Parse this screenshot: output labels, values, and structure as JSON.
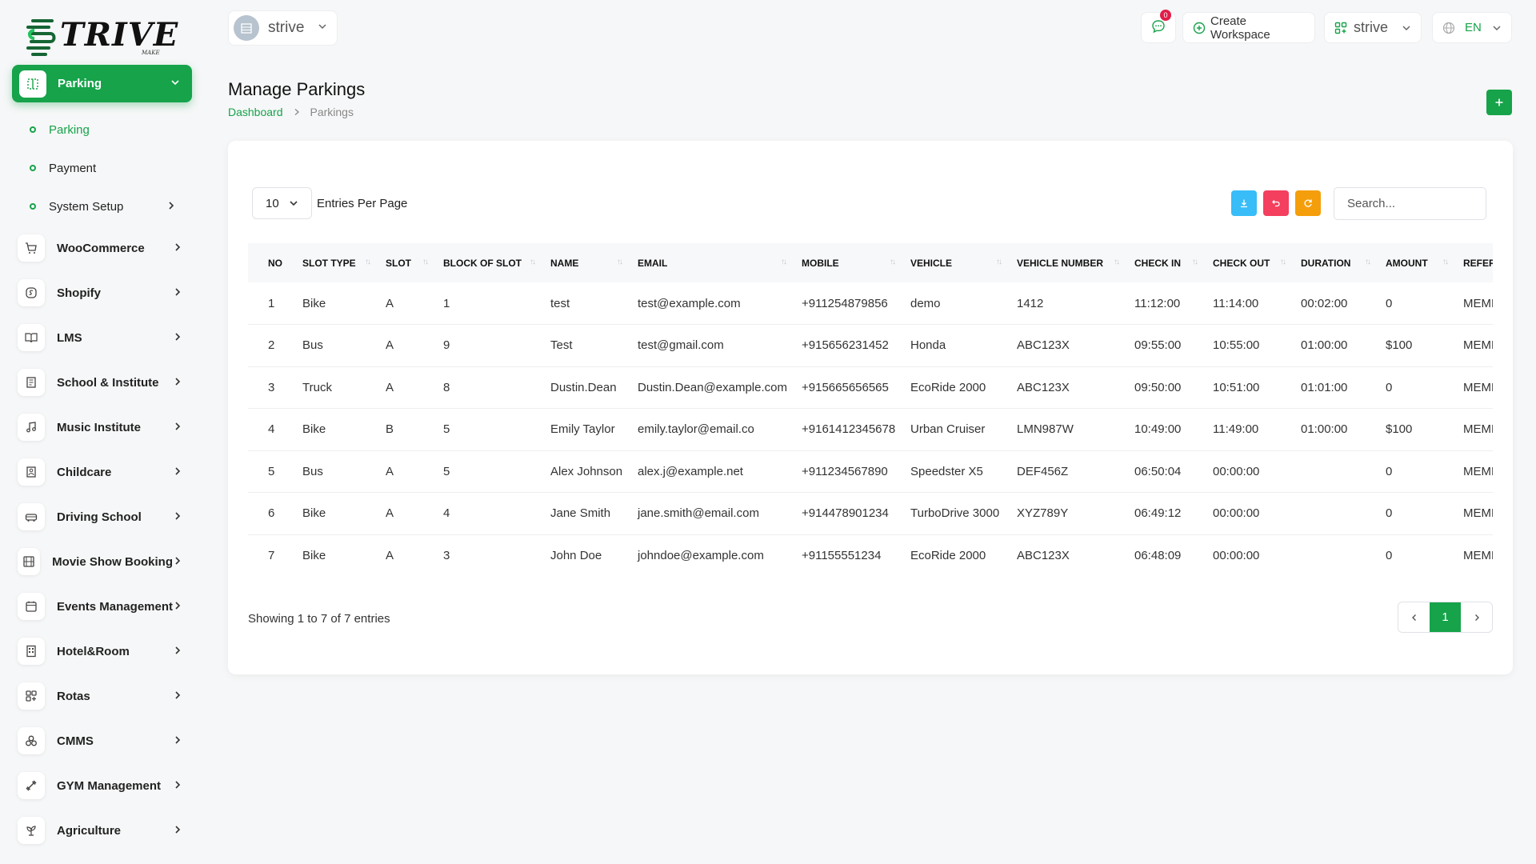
{
  "brand": {
    "logo_text": "TRIVE",
    "logo_sub": "MAKE",
    "accent": "#16a34a"
  },
  "workspace": {
    "name": "strive"
  },
  "topbar": {
    "notification_count": "0",
    "create_workspace_label": "Create Workspace",
    "workspace_switch_label": "strive",
    "language_label": "EN"
  },
  "sidebar": {
    "active": {
      "label": "Parking",
      "icon": "parking-icon"
    },
    "subitems": [
      {
        "label": "Parking",
        "active": true
      },
      {
        "label": "Payment"
      },
      {
        "label": "System Setup",
        "has_children": true
      }
    ],
    "items": [
      {
        "label": "WooCommerce",
        "icon": "cart-icon"
      },
      {
        "label": "Shopify",
        "icon": "shopify-icon"
      },
      {
        "label": "LMS",
        "icon": "book-icon"
      },
      {
        "label": "School & Institute",
        "icon": "school-icon"
      },
      {
        "label": "Music Institute",
        "icon": "music-icon"
      },
      {
        "label": "Childcare",
        "icon": "childcare-icon"
      },
      {
        "label": "Driving School",
        "icon": "car-icon"
      },
      {
        "label": "Movie Show Booking",
        "icon": "movie-icon"
      },
      {
        "label": "Events Management",
        "icon": "calendar-icon"
      },
      {
        "label": "Hotel&Room",
        "icon": "hotel-icon"
      },
      {
        "label": "Rotas",
        "icon": "grid-icon"
      },
      {
        "label": "CMMS",
        "icon": "cmms-icon"
      },
      {
        "label": "GYM Management",
        "icon": "dumbbell-icon"
      },
      {
        "label": "Agriculture",
        "icon": "plant-icon"
      }
    ]
  },
  "header": {
    "title": "Manage Parkings",
    "breadcrumb_home": "Dashboard",
    "breadcrumb_current": "Parkings"
  },
  "table_controls": {
    "entries_value": "10",
    "entries_label": "Entries Per Page",
    "search_placeholder": "Search...",
    "tool_colors": {
      "export": "#38bdf8",
      "undo": "#f43f5e",
      "refresh": "#f59e0b"
    }
  },
  "table": {
    "columns": [
      "NO",
      "SLOT TYPE",
      "SLOT",
      "BLOCK OF SLOT",
      "NAME",
      "EMAIL",
      "MOBILE",
      "VEHICLE",
      "VEHICLE NUMBER",
      "CHECK IN",
      "CHECK OUT",
      "DURATION",
      "AMOUNT",
      "REFER"
    ],
    "rows": [
      [
        "1",
        "Bike",
        "A",
        "1",
        "test",
        "test@example.com",
        "+911254879856",
        "demo",
        "1412",
        "11:12:00",
        "11:14:00",
        "00:02:00",
        "0",
        "MEMB"
      ],
      [
        "2",
        "Bus",
        "A",
        "9",
        "Test",
        "test@gmail.com",
        "+915656231452",
        "Honda",
        "ABC123X",
        "09:55:00",
        "10:55:00",
        "01:00:00",
        "$100",
        "MEMB"
      ],
      [
        "3",
        "Truck",
        "A",
        "8",
        "Dustin.Dean",
        "Dustin.Dean@example.com",
        "+915665656565",
        "EcoRide 2000",
        "ABC123X",
        "09:50:00",
        "10:51:00",
        "01:01:00",
        "0",
        "MEMB"
      ],
      [
        "4",
        "Bike",
        "B",
        "5",
        "Emily Taylor",
        "emily.taylor@email.co",
        "+9161412345678",
        "Urban Cruiser",
        "LMN987W",
        "10:49:00",
        "11:49:00",
        "01:00:00",
        "$100",
        "MEMB"
      ],
      [
        "5",
        "Bus",
        "A",
        "5",
        "Alex Johnson",
        "alex.j@example.net",
        "+911234567890",
        "Speedster X5",
        "DEF456Z",
        "06:50:04",
        "00:00:00",
        "",
        "0",
        "MEMB"
      ],
      [
        "6",
        "Bike",
        "A",
        "4",
        "Jane Smith",
        "jane.smith@email.com",
        "+914478901234",
        "TurboDrive 3000",
        "XYZ789Y",
        "06:49:12",
        "00:00:00",
        "",
        "0",
        "MEMB"
      ],
      [
        "7",
        "Bike",
        "A",
        "3",
        "John Doe",
        "johndoe@example.com",
        "+91155551234",
        "EcoRide 2000",
        "ABC123X",
        "06:48:09",
        "00:00:00",
        "",
        "0",
        "MEMB"
      ]
    ]
  },
  "footer": {
    "showing": "Showing 1 to 7 of 7 entries",
    "current_page": "1"
  }
}
